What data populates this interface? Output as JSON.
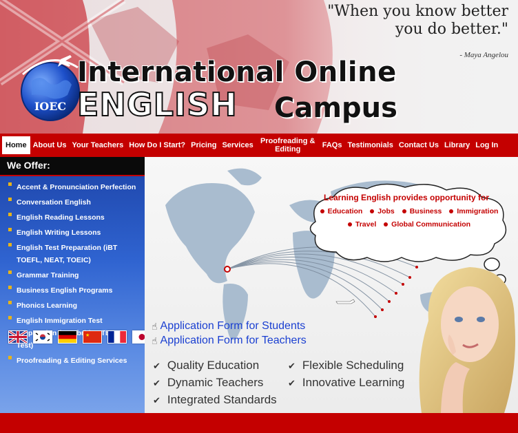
{
  "header": {
    "quote_line1": "\"When you know better",
    "quote_line2": "you do better.\"",
    "quote_author": "- Maya Angelou",
    "logo_badge": "IOEC",
    "logo_line1": "International Online",
    "logo_english": "ENGLISH",
    "logo_campus": "Campus"
  },
  "nav": {
    "items": [
      {
        "label": "Home"
      },
      {
        "label": "About Us"
      },
      {
        "label": "Your Teachers"
      },
      {
        "label": "How Do I Start?"
      },
      {
        "label": "Pricing"
      },
      {
        "label": "Services"
      },
      {
        "label": "Proofreading & Editing"
      },
      {
        "label": "FAQs"
      },
      {
        "label": "Testimonials"
      },
      {
        "label": "Contact Us"
      },
      {
        "label": "Library"
      },
      {
        "label": "Log In"
      }
    ]
  },
  "sidebar": {
    "title": "We Offer:",
    "items": [
      {
        "label": "Accent & Pronunciation Perfection"
      },
      {
        "label": "Conversation English"
      },
      {
        "label": "English Reading Lessons"
      },
      {
        "label": "English Writing Lessons"
      },
      {
        "label": "English Test Preparation (iBT TOEFL, NEAT, TOEIC)"
      },
      {
        "label": "Grammar Training"
      },
      {
        "label": "Business English Programs"
      },
      {
        "label": "Phonics Learning"
      },
      {
        "label": "English Immigration Test Preparation (Cambridge TESOL Test)"
      },
      {
        "label": "Proofreading & Editing Services"
      }
    ],
    "flags": [
      "uk-flag",
      "korea-flag",
      "germany-flag",
      "china-flag",
      "france-flag",
      "japan-flag"
    ]
  },
  "main": {
    "cloud_title": "Learning English provides opportunity for",
    "cloud_row1": [
      "Education",
      "Jobs",
      "Business",
      "Immigration"
    ],
    "cloud_row2": [
      "Travel",
      "Global Communication"
    ],
    "app_students": "Application Form for Students",
    "app_teachers": "Application Form for Teachers",
    "features": [
      "Quality Education",
      "Flexible Scheduling",
      "Dynamic Teachers",
      "Innovative Learning",
      "Integrated Standards"
    ]
  },
  "colors": {
    "brand_red": "#c40000",
    "sidebar_blue": "#2f63d0",
    "link_blue": "#1a3fd1",
    "bullet_gold": "#e8b418"
  }
}
